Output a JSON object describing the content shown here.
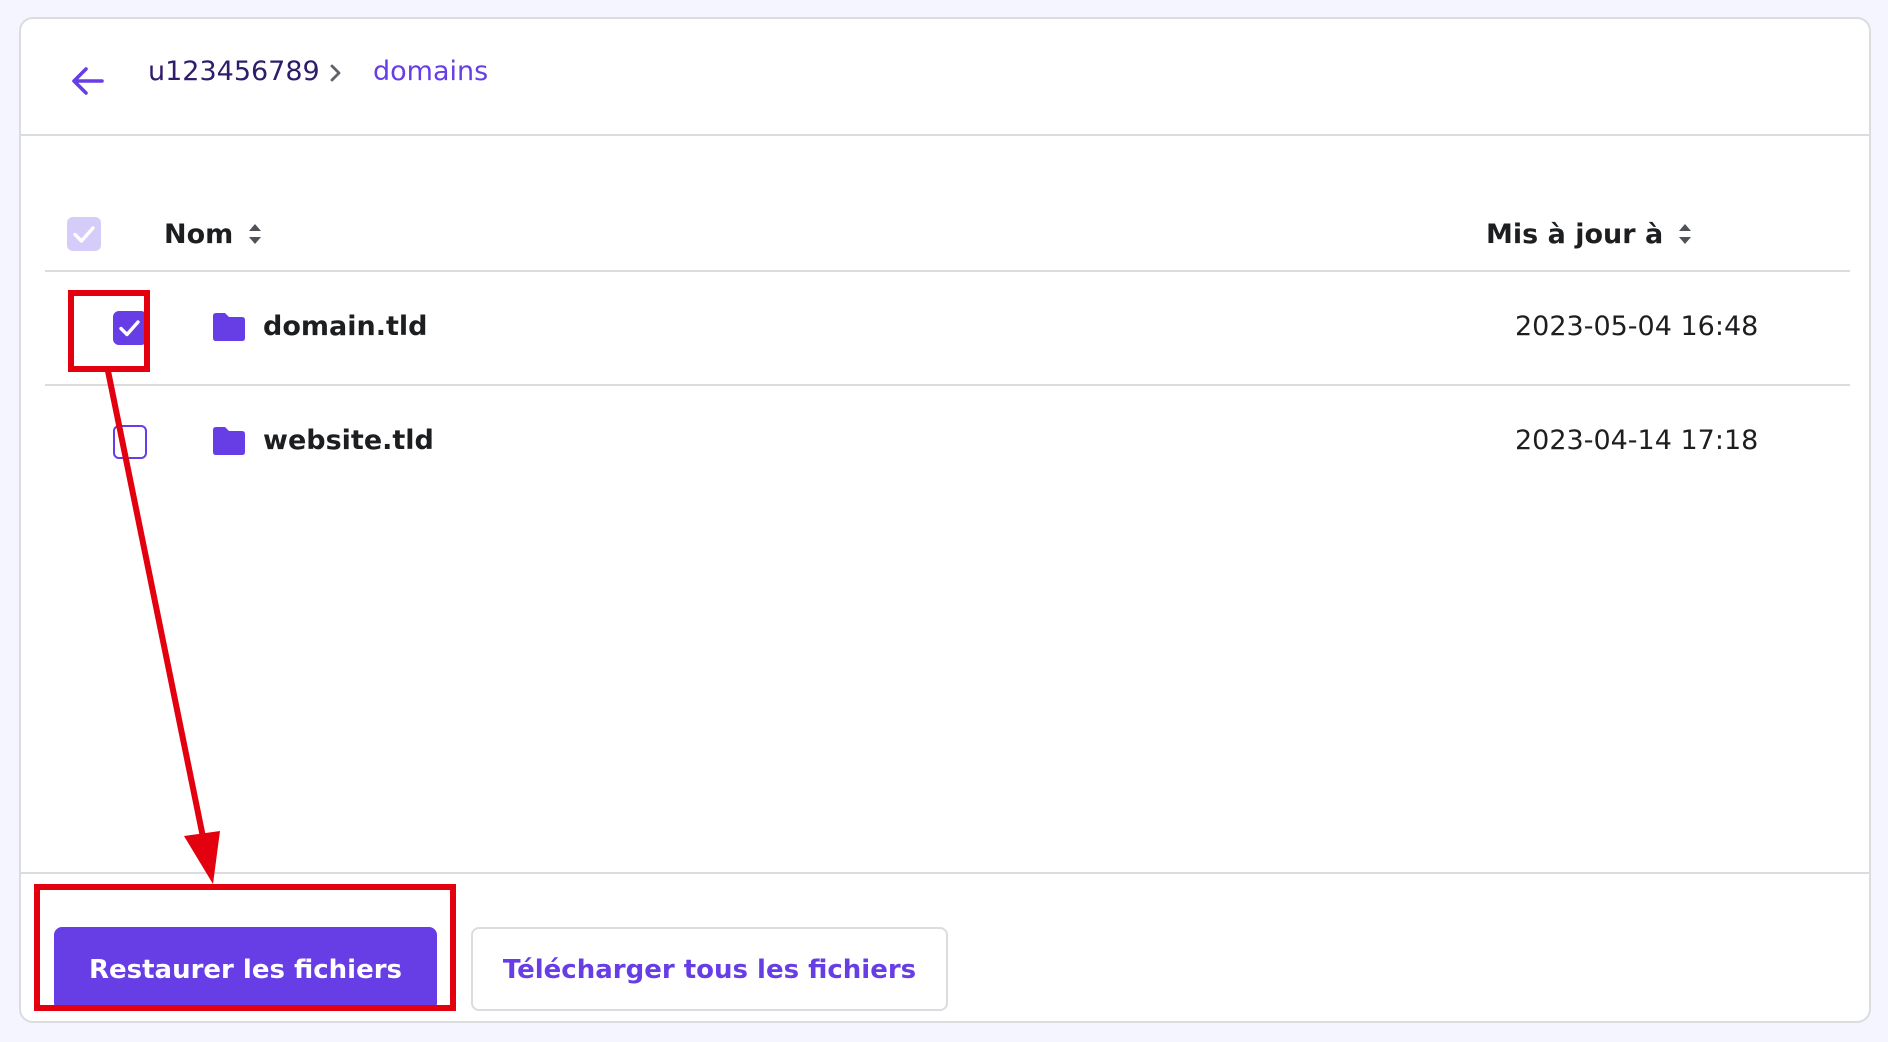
{
  "breadcrumb": {
    "root": "u123456789",
    "current": "domains"
  },
  "table": {
    "columns": {
      "name": "Nom",
      "updated": "Mis à jour à"
    },
    "rows": [
      {
        "name": "domain.tld",
        "updated": "2023-05-04 16:48",
        "selected": true
      },
      {
        "name": "website.tld",
        "updated": "2023-04-14 17:18",
        "selected": false
      }
    ]
  },
  "actions": {
    "restore": "Restaurer les fichiers",
    "download_all": "Télécharger tous les fichiers"
  },
  "icons": {
    "back": "arrow-left-icon",
    "separator": "chevron-right-icon",
    "folder": "folder-icon",
    "sort": "sort-icon",
    "check": "check-icon"
  },
  "colors": {
    "accent": "#673de6",
    "accent_light": "#d6ccfa",
    "annotation": "#e3000f",
    "text": "#1d1e20",
    "border": "#dadce0",
    "page_bg": "#f4f5ff"
  }
}
